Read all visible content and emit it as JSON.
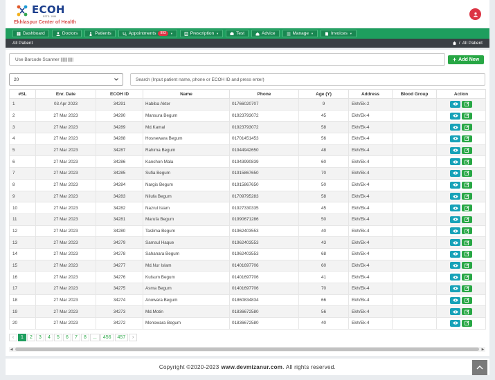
{
  "header": {
    "logo_text": "ECOH",
    "logo_estd": "ESTD. 1999",
    "logo_subtitle": "Ekhlaspur Center of Health",
    "user_icon": "user-icon"
  },
  "nav": [
    {
      "label": "Dashboard",
      "icon": "dashboard-icon"
    },
    {
      "label": "Doctors",
      "icon": "doctor-icon"
    },
    {
      "label": "Patients",
      "icon": "patient-icon"
    },
    {
      "label": "Appointments",
      "icon": "stethoscope-icon",
      "badge": "993",
      "caret": true
    },
    {
      "label": "Prescription",
      "icon": "prescription-icon",
      "caret": true
    },
    {
      "label": "Test",
      "icon": "test-icon"
    },
    {
      "label": "Advice",
      "icon": "advice-icon"
    },
    {
      "label": "Manage",
      "icon": "list-icon",
      "caret": true
    },
    {
      "label": "Invoices",
      "icon": "invoice-icon",
      "caret": true
    }
  ],
  "subbar": {
    "title": "All Patient",
    "crumb_sep": "/",
    "crumb": "All Patient"
  },
  "barcode": {
    "text": "Use Barcode Scanner |||||||||||"
  },
  "add_new": {
    "label": "Add New"
  },
  "page_size": {
    "value": "20"
  },
  "search": {
    "placeholder": "Search (Input patient name, phone or ECOH ID and press enter)"
  },
  "table": {
    "headers": [
      "#SL",
      "Enr. Date",
      "ECOH ID",
      "Name",
      "Phone",
      "Age (Y)",
      "Address",
      "Blood Group",
      "Action"
    ],
    "rows": [
      [
        "1",
        "03 Apr 2023",
        "34291",
        "Habiba Akter",
        "01766020707",
        "9",
        "Ekh/Ek-2",
        ""
      ],
      [
        "2",
        "27 Mar 2023",
        "34290",
        "Mansura Begum",
        "01923793072",
        "45",
        "Ekh/Ek-4",
        ""
      ],
      [
        "3",
        "27 Mar 2023",
        "34289",
        "Md.Kamal",
        "01923793072",
        "58",
        "Ekh/Ek-4",
        ""
      ],
      [
        "4",
        "27 Mar 2023",
        "34288",
        "Hosnewara Begum",
        "01701451453",
        "56",
        "Ekh/Ek-4",
        ""
      ],
      [
        "5",
        "27 Mar 2023",
        "34287",
        "Rahima Begum",
        "01944942650",
        "48",
        "Ekh/Ek-4",
        ""
      ],
      [
        "6",
        "27 Mar 2023",
        "34286",
        "Kanchon Mala",
        "01943990839",
        "60",
        "Ekh/Ek-4",
        ""
      ],
      [
        "7",
        "27 Mar 2023",
        "34285",
        "Sufia Begum",
        "01915867650",
        "70",
        "Ekh/Ek-4",
        ""
      ],
      [
        "8",
        "27 Mar 2023",
        "34284",
        "Nargis Begum",
        "01915867650",
        "50",
        "Ekh/Ek-4",
        ""
      ],
      [
        "9",
        "27 Mar 2023",
        "34283",
        "Nilufa Begum",
        "01709795283",
        "58",
        "Ekh/Ek-4",
        ""
      ],
      [
        "10",
        "27 Mar 2023",
        "34282",
        "Nazrul Islam",
        "01927330335",
        "45",
        "Ekh/Ek-4",
        ""
      ],
      [
        "11",
        "27 Mar 2023",
        "34281",
        "Marufa Begum",
        "01990671286",
        "50",
        "Ekh/Ek-4",
        ""
      ],
      [
        "12",
        "27 Mar 2023",
        "34280",
        "Taslima Begum",
        "01962403553",
        "40",
        "Ekh/Ek-4",
        ""
      ],
      [
        "13",
        "27 Mar 2023",
        "34279",
        "Samsul Haque",
        "01962403553",
        "43",
        "Ekh/Ek-4",
        ""
      ],
      [
        "14",
        "27 Mar 2023",
        "34278",
        "Sahanara Begum",
        "01962403553",
        "68",
        "Ekh/Ek-4",
        ""
      ],
      [
        "15",
        "27 Mar 2023",
        "34277",
        "Md.Nur Islam",
        "01401697706",
        "60",
        "Ekh/Ek-4",
        ""
      ],
      [
        "16",
        "27 Mar 2023",
        "34276",
        "Kulsum Begum",
        "01401697706",
        "41",
        "Ekh/Ek-4",
        ""
      ],
      [
        "17",
        "27 Mar 2023",
        "34275",
        "Asma Begum",
        "01401697706",
        "70",
        "Ekh/Ek-4",
        ""
      ],
      [
        "18",
        "27 Mar 2023",
        "34274",
        "Anowara Begum",
        "01860834834",
        "66",
        "Ekh/Ek-4",
        ""
      ],
      [
        "19",
        "27 Mar 2023",
        "34273",
        "Md.Motin",
        "01836672580",
        "56",
        "Ekh/Ek-4",
        ""
      ],
      [
        "20",
        "27 Mar 2023",
        "34272",
        "Monowara Begum",
        "01836672580",
        "40",
        "Ekh/Ek-4",
        ""
      ]
    ]
  },
  "pagination": [
    "‹",
    "1",
    "2",
    "3",
    "4",
    "5",
    "6",
    "7",
    "8",
    "...",
    "456",
    "457",
    "›"
  ],
  "pagination_active": "1",
  "footer": {
    "copyright": "Copyright ©2020-2023",
    "site": "www.devmizanur.com",
    "rights": ". All rights reserved."
  },
  "colors": {
    "primary": "#1e9e5e",
    "danger": "#dc3545",
    "info": "#17a2b8",
    "success": "#28a745",
    "dark": "#3a3f44",
    "brand": "#1b3e8c"
  }
}
